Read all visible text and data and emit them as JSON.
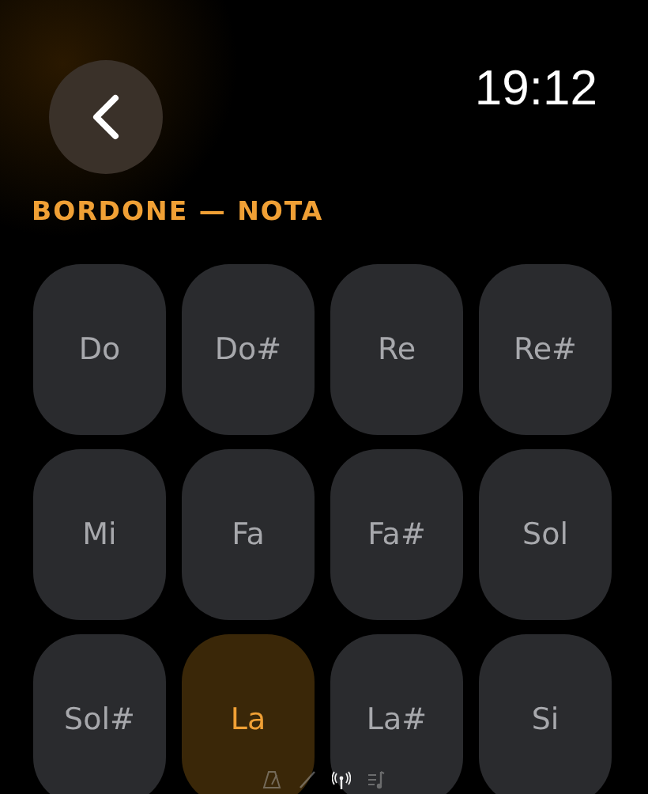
{
  "clock": "19:12",
  "title": "BORDONE — NOTA",
  "notes": [
    {
      "label": "Do",
      "selected": false
    },
    {
      "label": "Do#",
      "selected": false
    },
    {
      "label": "Re",
      "selected": false
    },
    {
      "label": "Re#",
      "selected": false
    },
    {
      "label": "Mi",
      "selected": false
    },
    {
      "label": "Fa",
      "selected": false
    },
    {
      "label": "Fa#",
      "selected": false
    },
    {
      "label": "Sol",
      "selected": false
    },
    {
      "label": "Sol#",
      "selected": false
    },
    {
      "label": "La",
      "selected": true
    },
    {
      "label": "La#",
      "selected": false
    },
    {
      "label": "Si",
      "selected": false
    }
  ],
  "pages": [
    {
      "kind": "metronome",
      "selected": false
    },
    {
      "kind": "fork",
      "selected": false
    },
    {
      "kind": "antenna",
      "selected": true
    },
    {
      "kind": "playlist",
      "selected": false
    }
  ]
}
